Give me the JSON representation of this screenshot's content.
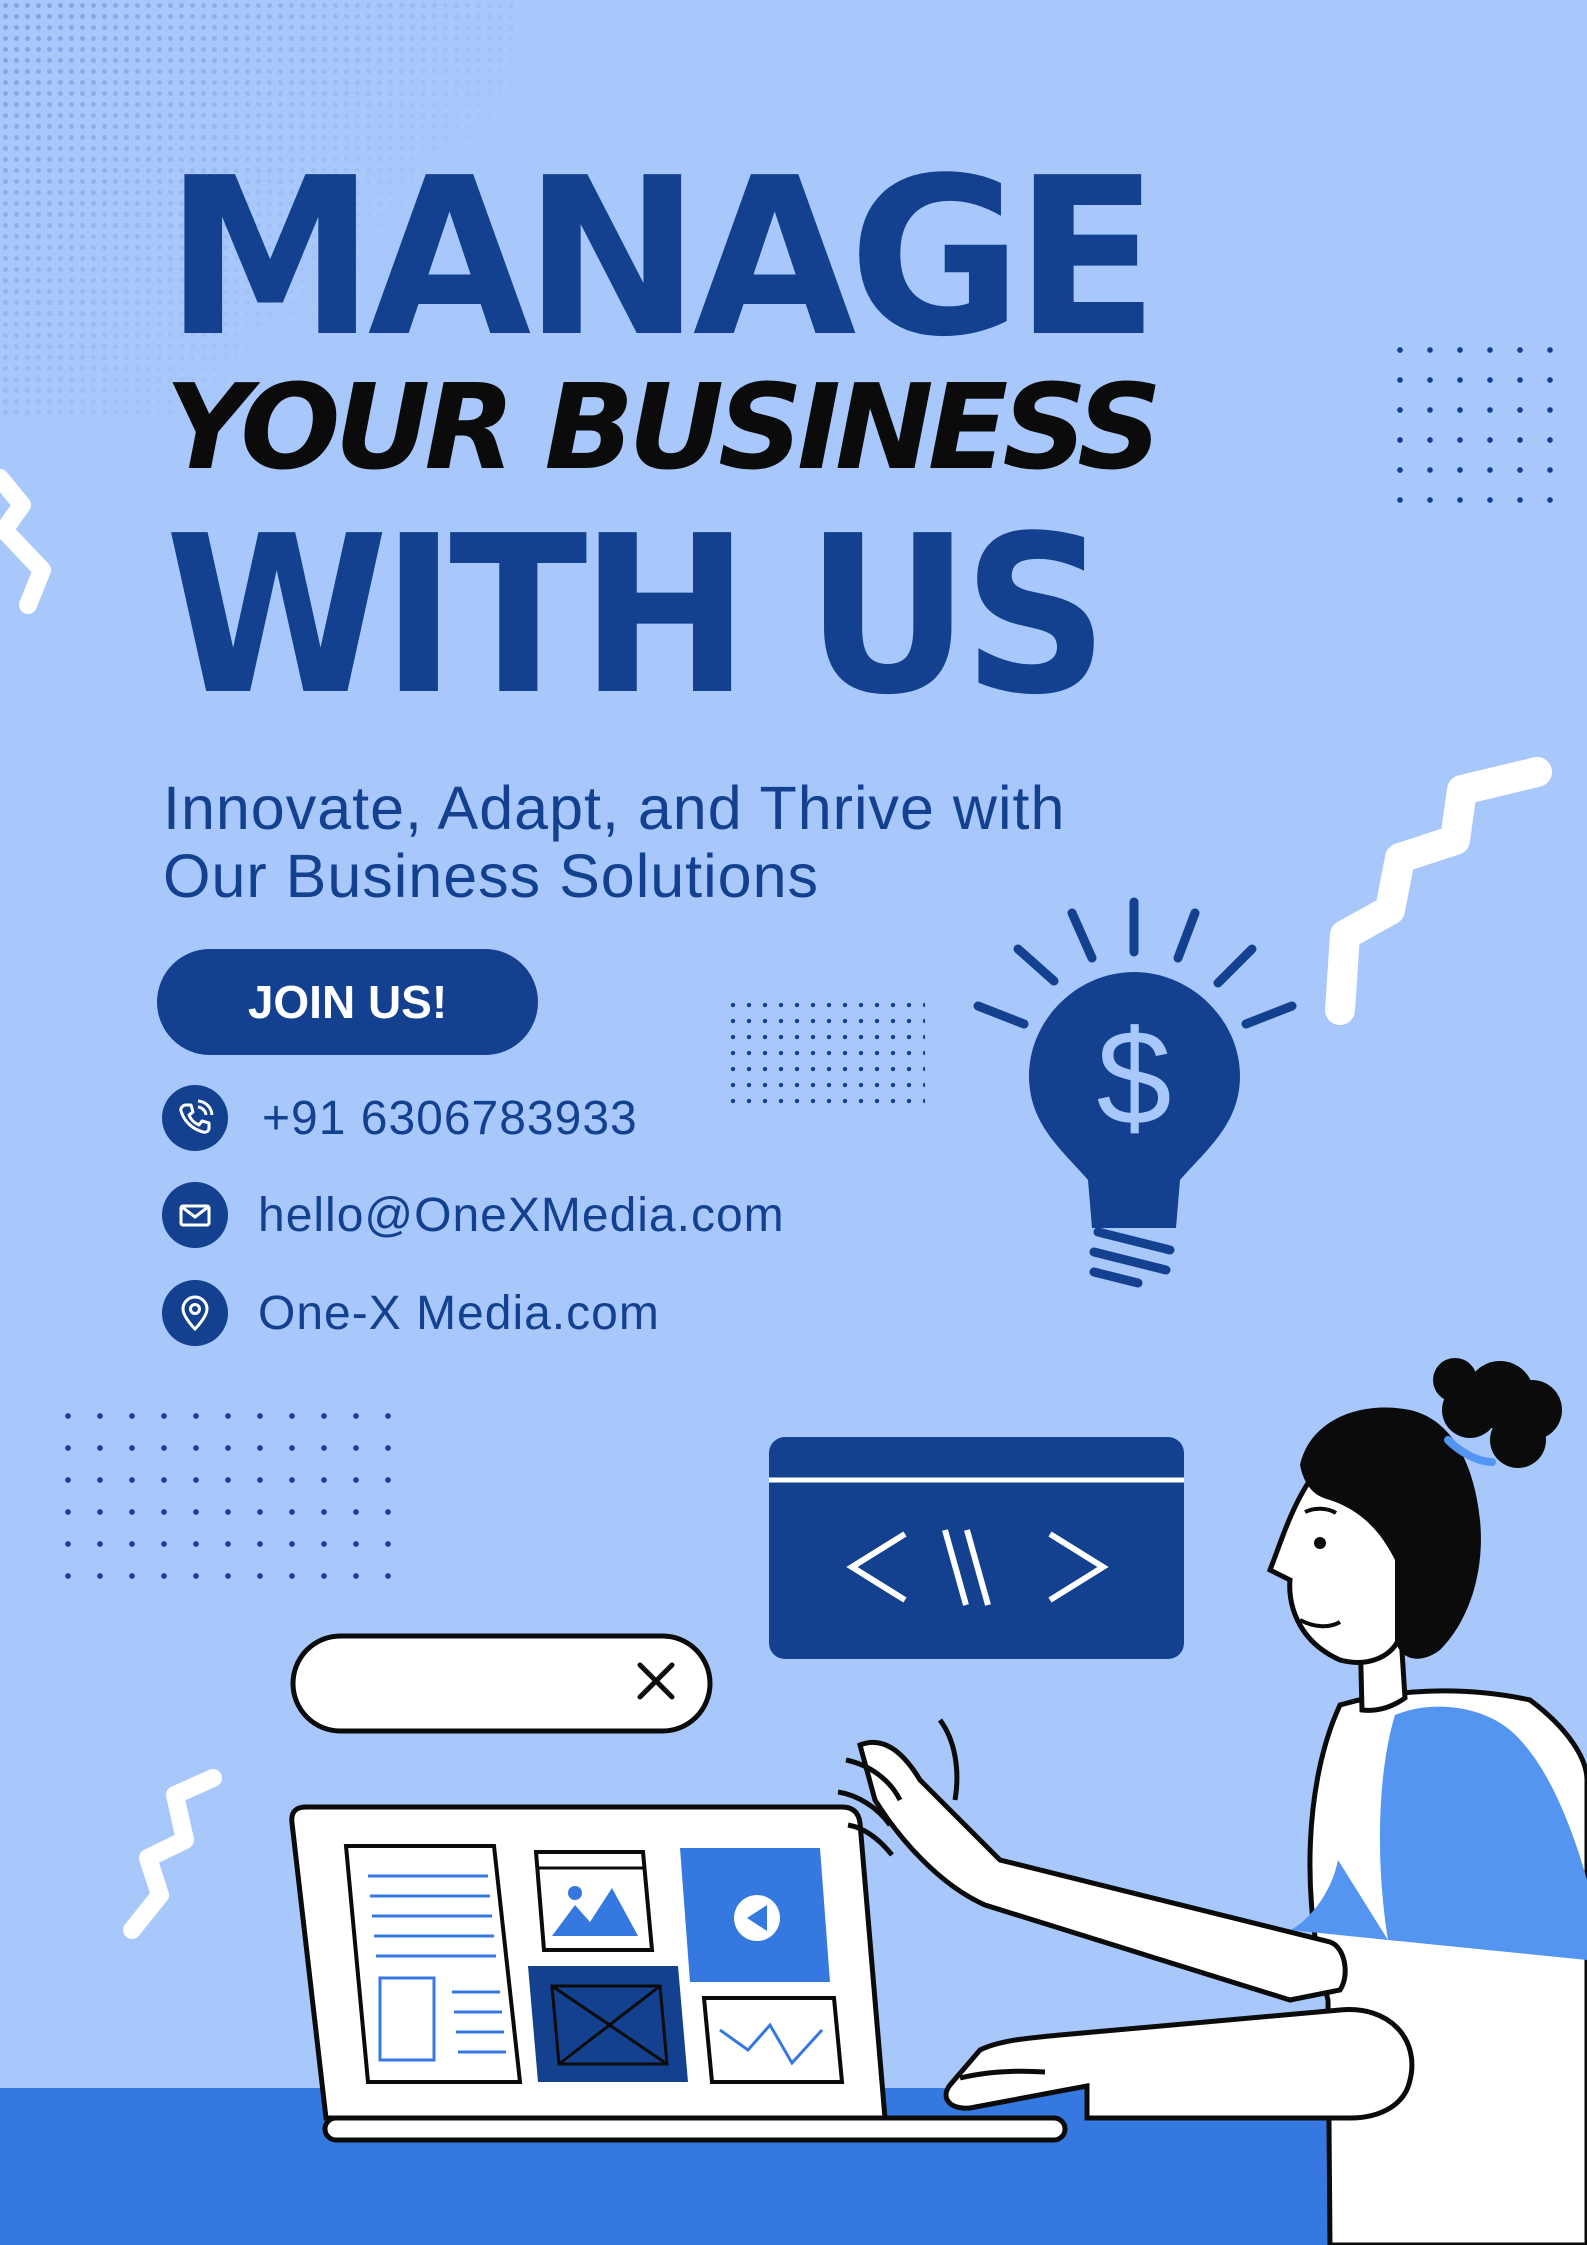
{
  "headline": {
    "line1": "MANAGE",
    "line2": "YOUR BUSINESS",
    "line3": "WITH US"
  },
  "subtitle": {
    "line1": "Innovate, Adapt, and Thrive with",
    "line2": "Our Business Solutions"
  },
  "cta": {
    "label": "JOIN US!"
  },
  "contacts": [
    {
      "icon": "phone-icon",
      "text": "+91 6306783933"
    },
    {
      "icon": "email-icon",
      "text": "hello@OneXMedia.com"
    },
    {
      "icon": "location-pin-icon",
      "text": "One-X Media.com"
    }
  ],
  "colors": {
    "background": "#a8c8fc",
    "primary": "#13408f",
    "accent": "#3478e0",
    "headline_dark": "#0b0b0b",
    "white": "#ffffff"
  },
  "illustration": {
    "code_window_icon": "code-brackets-icon",
    "idea_icon": "lightbulb-dollar-icon",
    "search_bar_icon": "close-icon",
    "laptop_icons": [
      "document-icon",
      "image-icon",
      "play-icon",
      "image-placeholder-icon",
      "line-chart-icon"
    ]
  }
}
